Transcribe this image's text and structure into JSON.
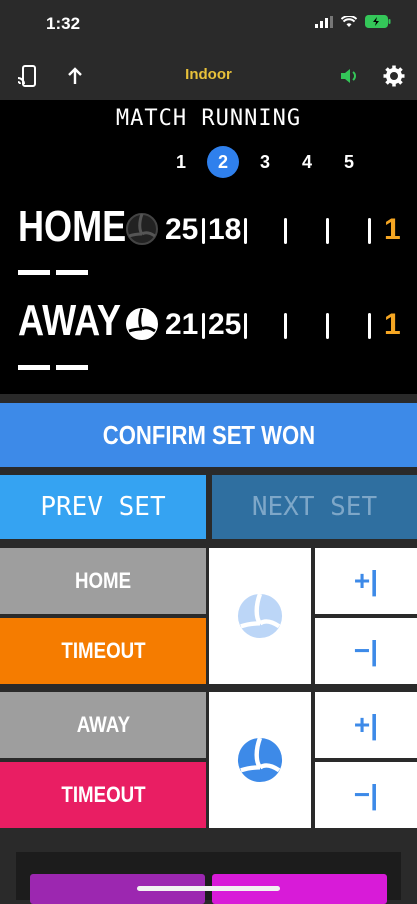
{
  "status_bar": {
    "time": "1:32"
  },
  "toolbar": {
    "title": "Indoor"
  },
  "board": {
    "state": "MATCH RUNNING",
    "sets": [
      "1",
      "2",
      "3",
      "4",
      "5"
    ],
    "active_set": "2",
    "home": {
      "name": "HOME",
      "scores": [
        "25",
        "18"
      ],
      "sets_won": "1"
    },
    "away": {
      "name": "AWAY",
      "scores": [
        "21",
        "25"
      ],
      "sets_won": "1"
    }
  },
  "actions": {
    "confirm": "CONFIRM SET WON",
    "prev": "PREV SET",
    "next": "NEXT SET"
  },
  "home_panel": {
    "name": "HOME",
    "timeout": "TIMEOUT",
    "plus": "+|",
    "minus": "−|"
  },
  "away_panel": {
    "name": "AWAY",
    "timeout": "TIMEOUT",
    "plus": "+|",
    "minus": "−|"
  },
  "colors": {
    "accent_blue": "#3d8ae8",
    "set_orange": "#f5a623",
    "timeout_home": "#f57c00",
    "timeout_away": "#e91e63",
    "grey": "#9e9e9e",
    "title_yellow": "#e8c13a"
  },
  "icons": [
    "cast-icon",
    "share-icon",
    "speaker-icon",
    "gear-icon",
    "volleyball-icon",
    "signal-icon",
    "wifi-icon",
    "battery-icon"
  ]
}
